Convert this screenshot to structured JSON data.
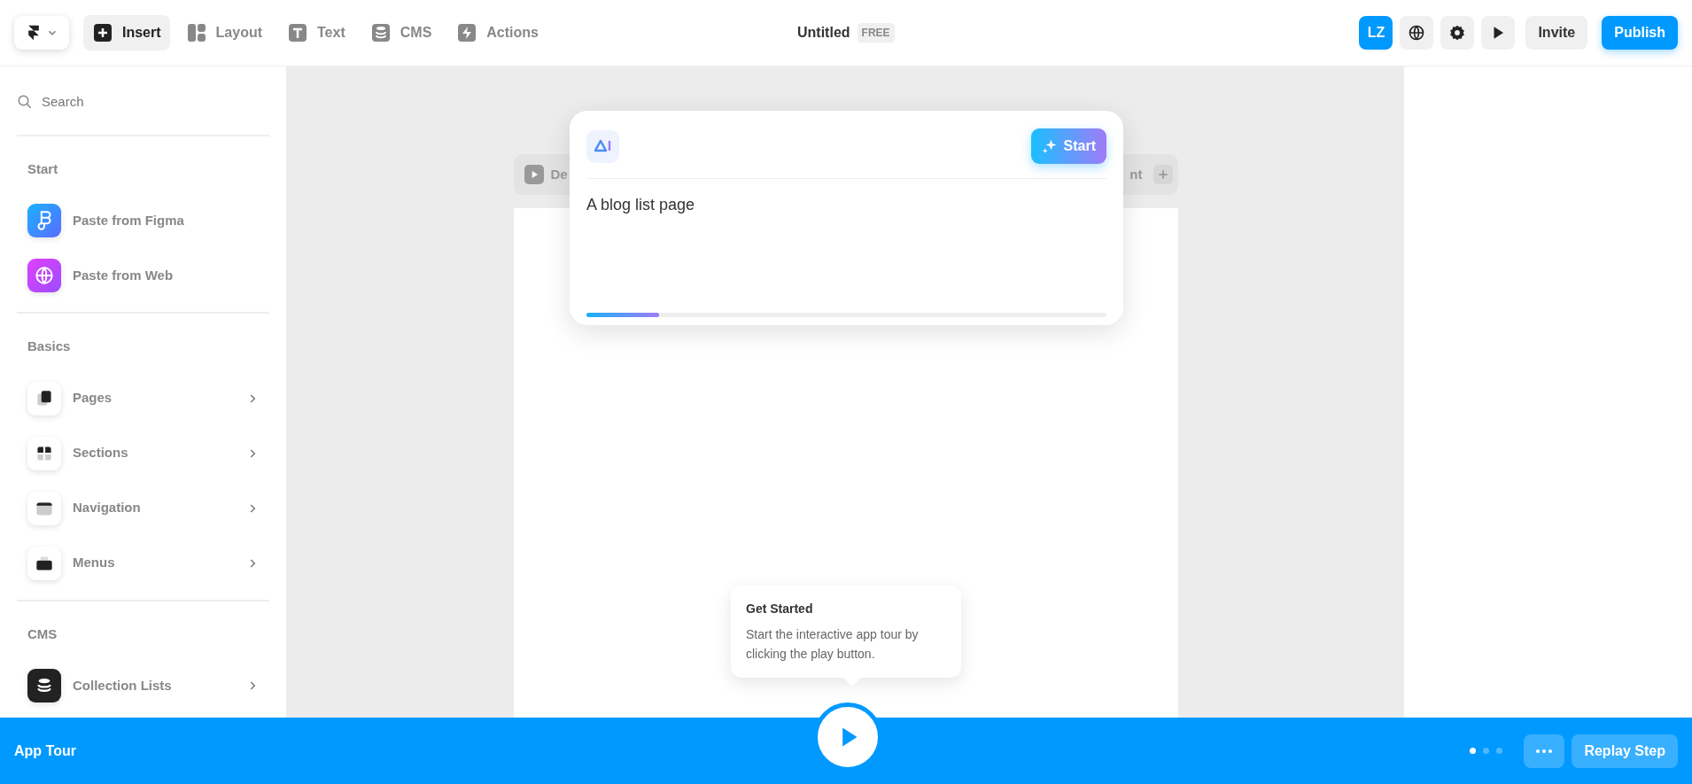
{
  "toolbar": {
    "tools": [
      {
        "label": "Insert",
        "selected": true
      },
      {
        "label": "Layout",
        "selected": false
      },
      {
        "label": "Text",
        "selected": false
      },
      {
        "label": "CMS",
        "selected": false
      },
      {
        "label": "Actions",
        "selected": false
      }
    ],
    "title": "Untitled",
    "plan": "FREE",
    "avatar": "LZ",
    "invite": "Invite",
    "publish": "Publish"
  },
  "sidebar": {
    "search": {
      "placeholder": "Search"
    },
    "sections": [
      {
        "title": "Start",
        "items": [
          {
            "label": "Paste from Figma",
            "kind": "action"
          },
          {
            "label": "Paste from Web",
            "kind": "action"
          }
        ]
      },
      {
        "title": "Basics",
        "items": [
          {
            "label": "Pages",
            "kind": "submenu"
          },
          {
            "label": "Sections",
            "kind": "submenu"
          },
          {
            "label": "Navigation",
            "kind": "submenu"
          },
          {
            "label": "Menus",
            "kind": "submenu"
          }
        ]
      },
      {
        "title": "CMS",
        "items": [
          {
            "label": "Collection Lists",
            "kind": "submenu"
          }
        ]
      }
    ]
  },
  "frame_header": {
    "left": "De",
    "right": "nt"
  },
  "prompt": {
    "value": "A blog list page",
    "start": "Start",
    "level": 0.14
  },
  "tooltip": {
    "title": "Get Started",
    "body": "Start the interactive app tour by clicking the play button."
  },
  "tour_bar": {
    "title": "App Tour",
    "steps": [
      {
        "selected": true
      },
      {
        "selected": false
      },
      {
        "selected": false
      }
    ],
    "replay": "Replay Step"
  }
}
